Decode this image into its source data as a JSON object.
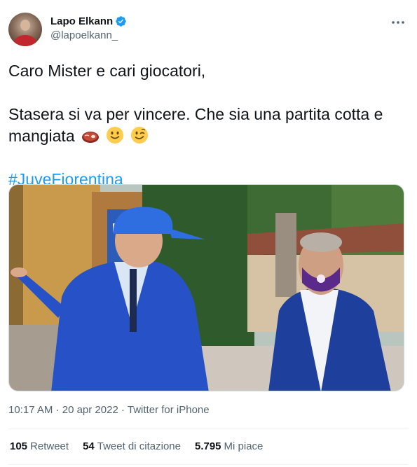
{
  "author": {
    "display_name": "Lapo Elkann",
    "handle": "@lapoelkann_",
    "verified": true
  },
  "tweet": {
    "line1": "Caro Mister e cari giocatori,",
    "line2": "Stasera si va per vincere. Che sia una partita cotta e",
    "line3": "mangiata",
    "emojis": [
      "steak-emoji",
      "slightly-smiling-face-emoji",
      "winking-face-emoji"
    ],
    "hashtag": "#JuveFiorentina"
  },
  "media": {
    "description_icon": "photo-two-men-outdoors"
  },
  "meta": {
    "time": "10:17 AM",
    "separator1": "·",
    "date": "20 apr 2022",
    "separator2": "·",
    "source": "Twitter for iPhone"
  },
  "stats": {
    "retweets_count": "105",
    "retweets_label": "Retweet",
    "quotes_count": "54",
    "quotes_label": "Tweet di citazione",
    "likes_count": "5.795",
    "likes_label": "Mi piace"
  },
  "colors": {
    "accent": "#1d9bf0",
    "secondary_text": "#536471",
    "primary_text": "#0f1419"
  }
}
